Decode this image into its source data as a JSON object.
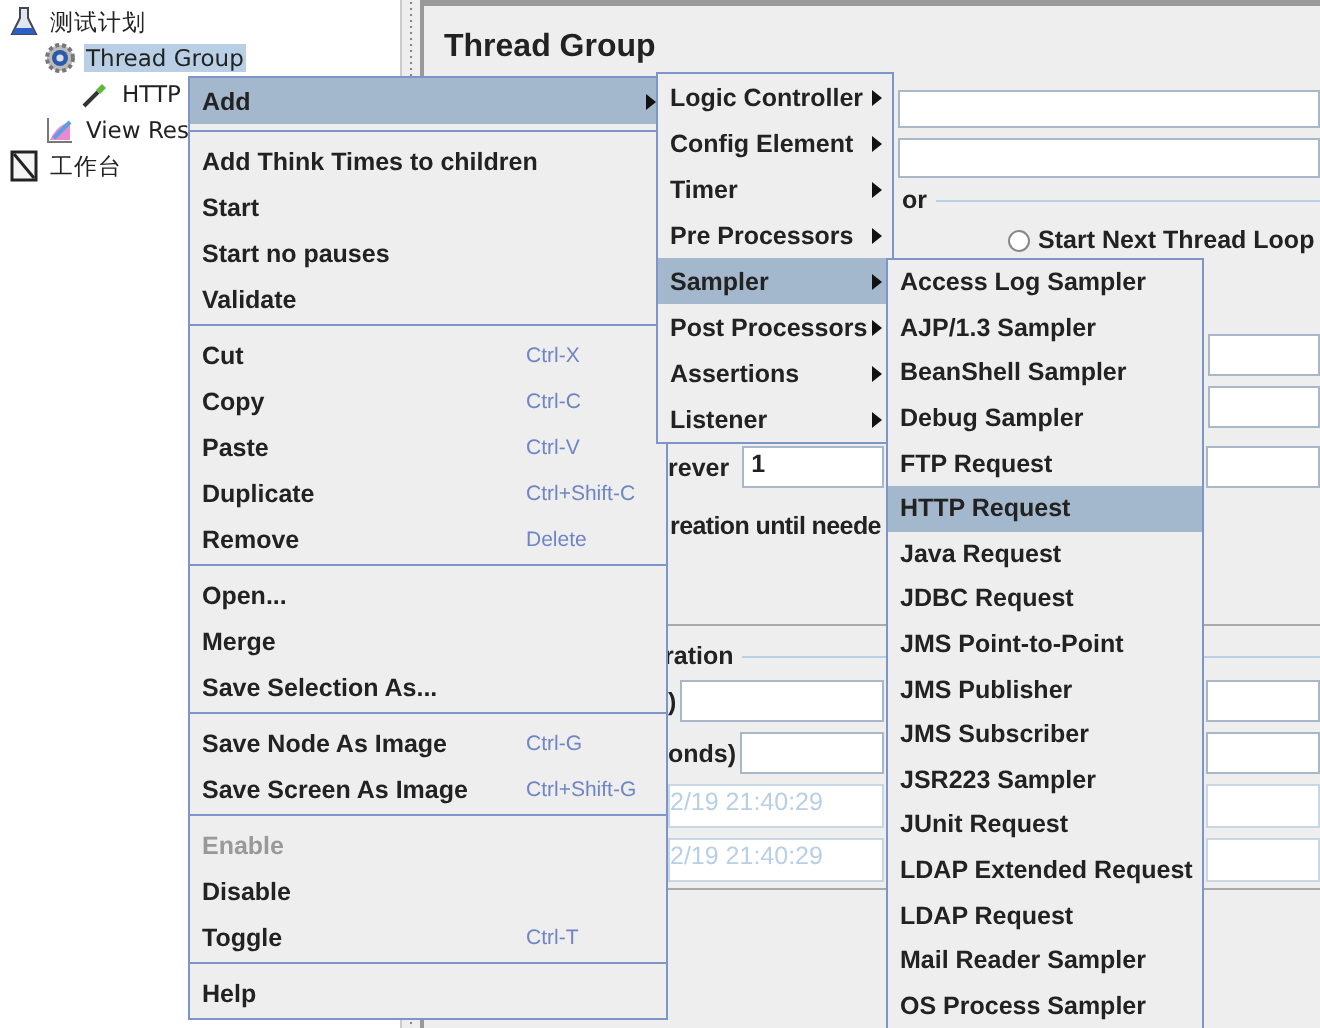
{
  "tree": [
    {
      "label": "测试计划",
      "kind": "plan",
      "selected": false,
      "children": [
        {
          "label": "Thread Group",
          "kind": "threads",
          "selected": true,
          "children": [
            {
              "label": "HTTP",
              "kind": "sampler",
              "selected": false
            }
          ]
        },
        {
          "label": "View Res",
          "kind": "listener",
          "selected": false
        }
      ]
    },
    {
      "label": "工作台",
      "kind": "workbench",
      "selected": false
    }
  ],
  "panel": {
    "title": "Thread Group",
    "legend_1": "or",
    "radio": {
      "label": "Start Next Thread Loop",
      "selected": false
    },
    "loop_label": "rever",
    "loop_value": "1",
    "delay_label": "reation until neede",
    "legend_2": "ration",
    "duration_label": ")",
    "startup_label": "onds)",
    "disabled_fields": [
      "2/19 21:40:29",
      "2/19 21:40:29"
    ]
  },
  "context_menu": [
    [
      {
        "label": "Add",
        "selected": true,
        "disabled": false,
        "submenu": true
      }
    ],
    [
      {
        "label": "Add Think Times to children",
        "selected": false,
        "disabled": false,
        "submenu": false
      },
      {
        "label": "Start",
        "selected": false,
        "disabled": false,
        "submenu": false
      },
      {
        "label": "Start no pauses",
        "selected": false,
        "disabled": false,
        "submenu": false
      },
      {
        "label": "Validate",
        "selected": false,
        "disabled": false,
        "submenu": false
      }
    ],
    [
      {
        "label": "Cut",
        "shortcut": "Ctrl-X",
        "selected": false,
        "disabled": false,
        "submenu": false
      },
      {
        "label": "Copy",
        "shortcut": "Ctrl-C",
        "selected": false,
        "disabled": false,
        "submenu": false
      },
      {
        "label": "Paste",
        "shortcut": "Ctrl-V",
        "selected": false,
        "disabled": false,
        "submenu": false
      },
      {
        "label": "Duplicate",
        "shortcut": "Ctrl+Shift-C",
        "selected": false,
        "disabled": false,
        "submenu": false
      },
      {
        "label": "Remove",
        "shortcut": "Delete",
        "selected": false,
        "disabled": false,
        "submenu": false
      }
    ],
    [
      {
        "label": "Open...",
        "selected": false,
        "disabled": false,
        "submenu": false
      },
      {
        "label": "Merge",
        "selected": false,
        "disabled": false,
        "submenu": false
      },
      {
        "label": "Save Selection As...",
        "selected": false,
        "disabled": false,
        "submenu": false
      }
    ],
    [
      {
        "label": "Save Node As Image",
        "shortcut": "Ctrl-G",
        "selected": false,
        "disabled": false,
        "submenu": false
      },
      {
        "label": "Save Screen As Image",
        "shortcut": "Ctrl+Shift-G",
        "selected": false,
        "disabled": false,
        "submenu": false
      }
    ],
    [
      {
        "label": "Enable",
        "selected": false,
        "disabled": true,
        "submenu": false
      },
      {
        "label": "Disable",
        "selected": false,
        "disabled": false,
        "submenu": false
      },
      {
        "label": "Toggle",
        "shortcut": "Ctrl-T",
        "selected": false,
        "disabled": false,
        "submenu": false
      }
    ],
    [
      {
        "label": "Help",
        "selected": false,
        "disabled": false,
        "submenu": false
      }
    ]
  ],
  "add_submenu": [
    {
      "label": "Logic Controller",
      "selected": false,
      "submenu": true
    },
    {
      "label": "Config Element",
      "selected": false,
      "submenu": true
    },
    {
      "label": "Timer",
      "selected": false,
      "submenu": true
    },
    {
      "label": "Pre Processors",
      "selected": false,
      "submenu": true
    },
    {
      "label": "Sampler",
      "selected": true,
      "submenu": true
    },
    {
      "label": "Post Processors",
      "selected": false,
      "submenu": true
    },
    {
      "label": "Assertions",
      "selected": false,
      "submenu": true
    },
    {
      "label": "Listener",
      "selected": false,
      "submenu": true
    }
  ],
  "sampler_submenu": [
    {
      "label": "Access Log Sampler",
      "selected": false
    },
    {
      "label": "AJP/1.3 Sampler",
      "selected": false
    },
    {
      "label": "BeanShell Sampler",
      "selected": false
    },
    {
      "label": "Debug Sampler",
      "selected": false
    },
    {
      "label": "FTP Request",
      "selected": false
    },
    {
      "label": "HTTP Request",
      "selected": true
    },
    {
      "label": "Java Request",
      "selected": false
    },
    {
      "label": "JDBC Request",
      "selected": false
    },
    {
      "label": "JMS Point-to-Point",
      "selected": false
    },
    {
      "label": "JMS Publisher",
      "selected": false
    },
    {
      "label": "JMS Subscriber",
      "selected": false
    },
    {
      "label": "JSR223 Sampler",
      "selected": false
    },
    {
      "label": "JUnit Request",
      "selected": false
    },
    {
      "label": "LDAP Extended Request",
      "selected": false
    },
    {
      "label": "LDAP Request",
      "selected": false
    },
    {
      "label": "Mail Reader Sampler",
      "selected": false
    },
    {
      "label": "OS Process Sampler",
      "selected": false
    }
  ]
}
